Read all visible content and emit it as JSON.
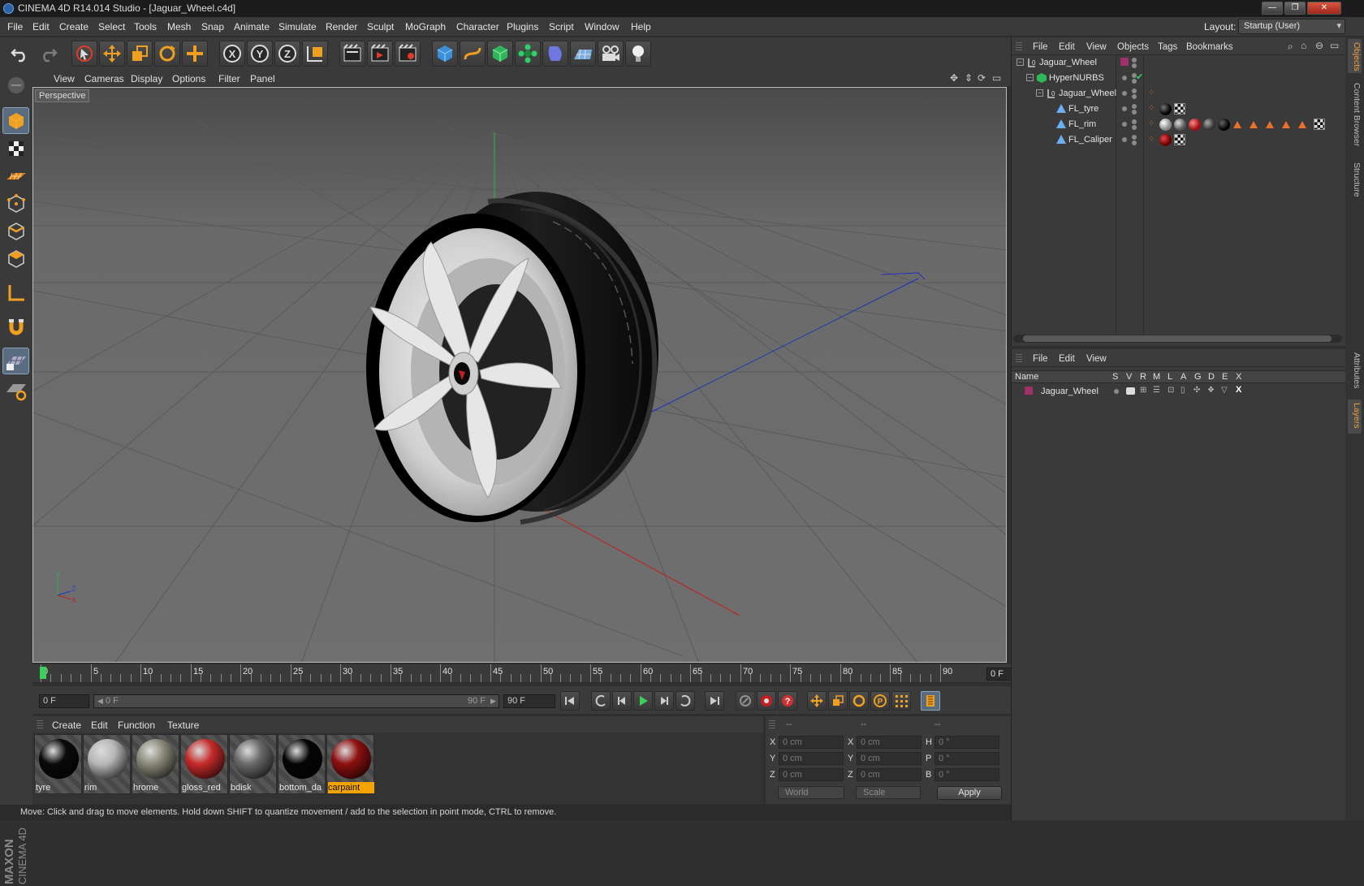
{
  "window": {
    "title": "CINEMA 4D R14.014 Studio - [Jaguar_Wheel.c4d]"
  },
  "menubar": {
    "items": [
      "File",
      "Edit",
      "Create",
      "Select",
      "Tools",
      "Mesh",
      "Snap",
      "Animate",
      "Simulate",
      "Render",
      "Sculpt",
      "MoGraph",
      "Character",
      "Plugins",
      "Script",
      "Window",
      "Help"
    ],
    "layout_label": "Layout:",
    "layout_value": "Startup (User)"
  },
  "toolbar": {
    "icons": [
      "undo-icon",
      "redo-icon",
      "live-selection-icon",
      "move-icon",
      "scale-icon",
      "rotate-icon",
      "add-icon",
      "x-axis-icon",
      "y-axis-icon",
      "z-axis-icon",
      "coordinate-system-icon",
      "render-view-icon",
      "render-picture-viewer-icon",
      "edit-render-settings-icon",
      "cube-primitive-icon",
      "spline-icon",
      "nurbs-icon",
      "array-icon",
      "deformer-icon",
      "floor-icon",
      "camera-icon",
      "light-icon"
    ],
    "axis_labels": [
      "X",
      "Y",
      "Z"
    ]
  },
  "left_tools": [
    "make-editable-icon",
    "model-mode-icon",
    "texture-mode-icon",
    "workplane-icon",
    "points-mode-icon",
    "edges-mode-icon",
    "polygons-mode-icon",
    "axis-mode-icon",
    "snap-magnet-icon",
    "locked-workplane-icon",
    "planar-workplane-icon"
  ],
  "viewport": {
    "menu": [
      "View",
      "Cameras",
      "Display",
      "Options",
      "Filter",
      "Panel"
    ],
    "label": "Perspective",
    "axis_labels": [
      "Y",
      "Z",
      "X"
    ]
  },
  "timeline": {
    "ticks": [
      "0",
      "5",
      "10",
      "15",
      "20",
      "25",
      "30",
      "35",
      "40",
      "45",
      "50",
      "55",
      "60",
      "65",
      "70",
      "75",
      "80",
      "85",
      "90"
    ],
    "current_frame": "0 F",
    "start_field": "0 F",
    "range_start": "0 F",
    "range_end": "90 F",
    "end_field": "90 F",
    "preview_arrow_left": "◀",
    "preview_arrow_right": "▶"
  },
  "materials": {
    "menu": [
      "Create",
      "Edit",
      "Function",
      "Texture"
    ],
    "items": [
      {
        "name": "tyre",
        "color": "#0a0a0a"
      },
      {
        "name": "rim",
        "color": "#b8b8b8"
      },
      {
        "name": "hrome",
        "color": "#8a8a7a"
      },
      {
        "name": "gloss_red",
        "color": "#c62a2a"
      },
      {
        "name": "bdisk",
        "color": "#6a6a6a"
      },
      {
        "name": "bottom_da",
        "color": "#050505"
      },
      {
        "name": "carpaint",
        "color": "#8e1010"
      }
    ],
    "selected": "carpaint"
  },
  "coordinates": {
    "headers": [
      "--",
      "--",
      "--"
    ],
    "rows": [
      {
        "l1": "X",
        "v1": "0 cm",
        "l2": "X",
        "v2": "0 cm",
        "l3": "H",
        "v3": "0 °"
      },
      {
        "l1": "Y",
        "v1": "0 cm",
        "l2": "Y",
        "v2": "0 cm",
        "l3": "P",
        "v3": "0 °"
      },
      {
        "l1": "Z",
        "v1": "0 cm",
        "l2": "Z",
        "v2": "0 cm",
        "l3": "B",
        "v3": "0 °"
      }
    ],
    "space": "World",
    "mode": "Scale",
    "apply_label": "Apply"
  },
  "statusbar": {
    "text": "Move: Click and drag to move elements. Hold down SHIFT to quantize movement / add to the selection in point mode, CTRL to remove."
  },
  "objects_panel": {
    "menu": [
      "File",
      "Edit",
      "View",
      "Objects",
      "Tags",
      "Bookmarks"
    ],
    "tree": [
      {
        "name": "Jaguar_Wheel"
      },
      {
        "name": "HyperNURBS"
      },
      {
        "name": "Jaguar_Wheel"
      },
      {
        "name": "FL_tyre"
      },
      {
        "name": "FL_rim"
      },
      {
        "name": "FL_Caliper"
      }
    ],
    "enabled_check": "✔"
  },
  "layers_panel": {
    "menu": [
      "File",
      "Edit",
      "View"
    ],
    "columns": [
      "Name",
      "S",
      "V",
      "R",
      "M",
      "L",
      "A",
      "G",
      "D",
      "E",
      "X"
    ],
    "layer_name": "Jaguar_Wheel",
    "layer_color": "#a0306a"
  },
  "right_tabs": [
    "Objects",
    "Content Browser",
    "Structure",
    "Attributes",
    "Layers"
  ],
  "brand": "MAXON CINEMA 4D"
}
